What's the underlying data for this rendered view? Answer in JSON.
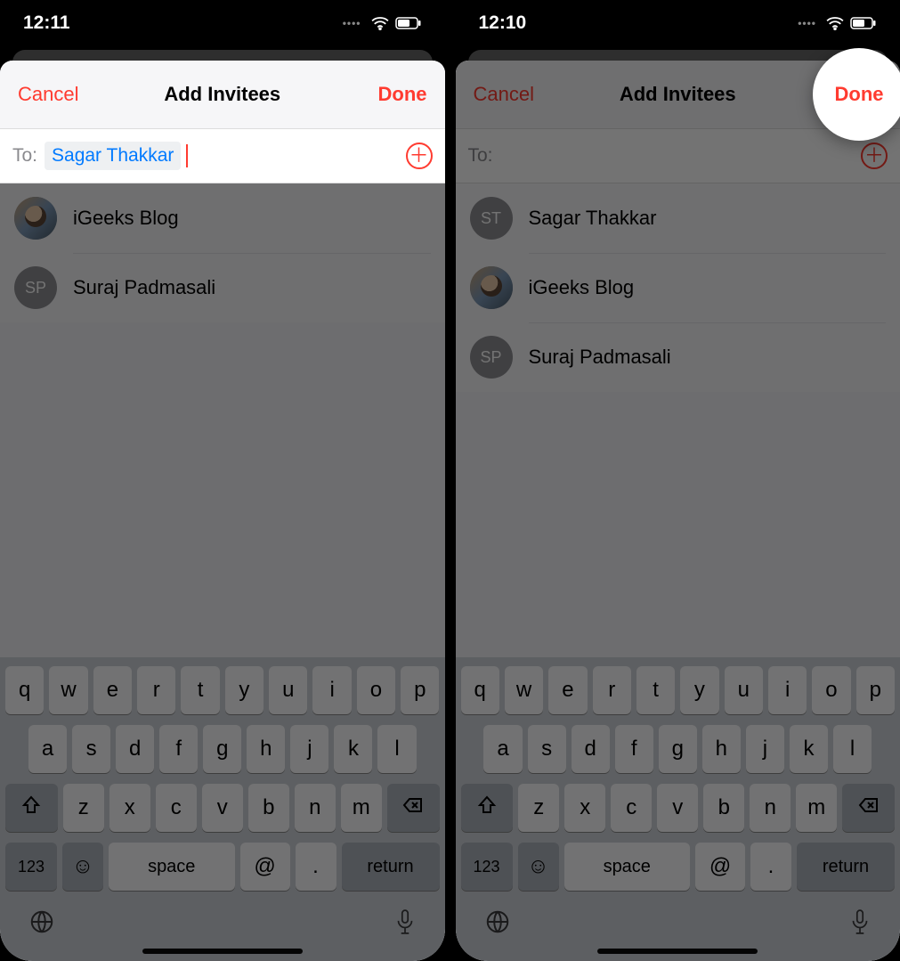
{
  "left": {
    "time": "12:11",
    "nav": {
      "cancel": "Cancel",
      "title": "Add Invitees",
      "done": "Done"
    },
    "to": {
      "label": "To:",
      "chip": "Sagar Thakkar"
    },
    "contacts": [
      {
        "name": "iGeeks Blog",
        "avatarType": "img",
        "initials": ""
      },
      {
        "name": "Suraj Padmasali",
        "avatarType": "initials",
        "initials": "SP"
      }
    ]
  },
  "right": {
    "time": "12:10",
    "nav": {
      "cancel": "Cancel",
      "title": "Add Invitees",
      "done": "Done"
    },
    "to": {
      "label": "To:"
    },
    "contacts": [
      {
        "name": "Sagar Thakkar",
        "avatarType": "initials",
        "initials": "ST"
      },
      {
        "name": "iGeeks Blog",
        "avatarType": "img",
        "initials": ""
      },
      {
        "name": "Suraj Padmasali",
        "avatarType": "initials",
        "initials": "SP"
      }
    ],
    "highlight": "Done"
  },
  "keyboard": {
    "row1": [
      "q",
      "w",
      "e",
      "r",
      "t",
      "y",
      "u",
      "i",
      "o",
      "p"
    ],
    "row2": [
      "a",
      "s",
      "d",
      "f",
      "g",
      "h",
      "j",
      "k",
      "l"
    ],
    "row3": [
      "z",
      "x",
      "c",
      "v",
      "b",
      "n",
      "m"
    ],
    "numKey": "123",
    "space": "space",
    "at": "@",
    "dot": ".",
    "return": "return"
  }
}
